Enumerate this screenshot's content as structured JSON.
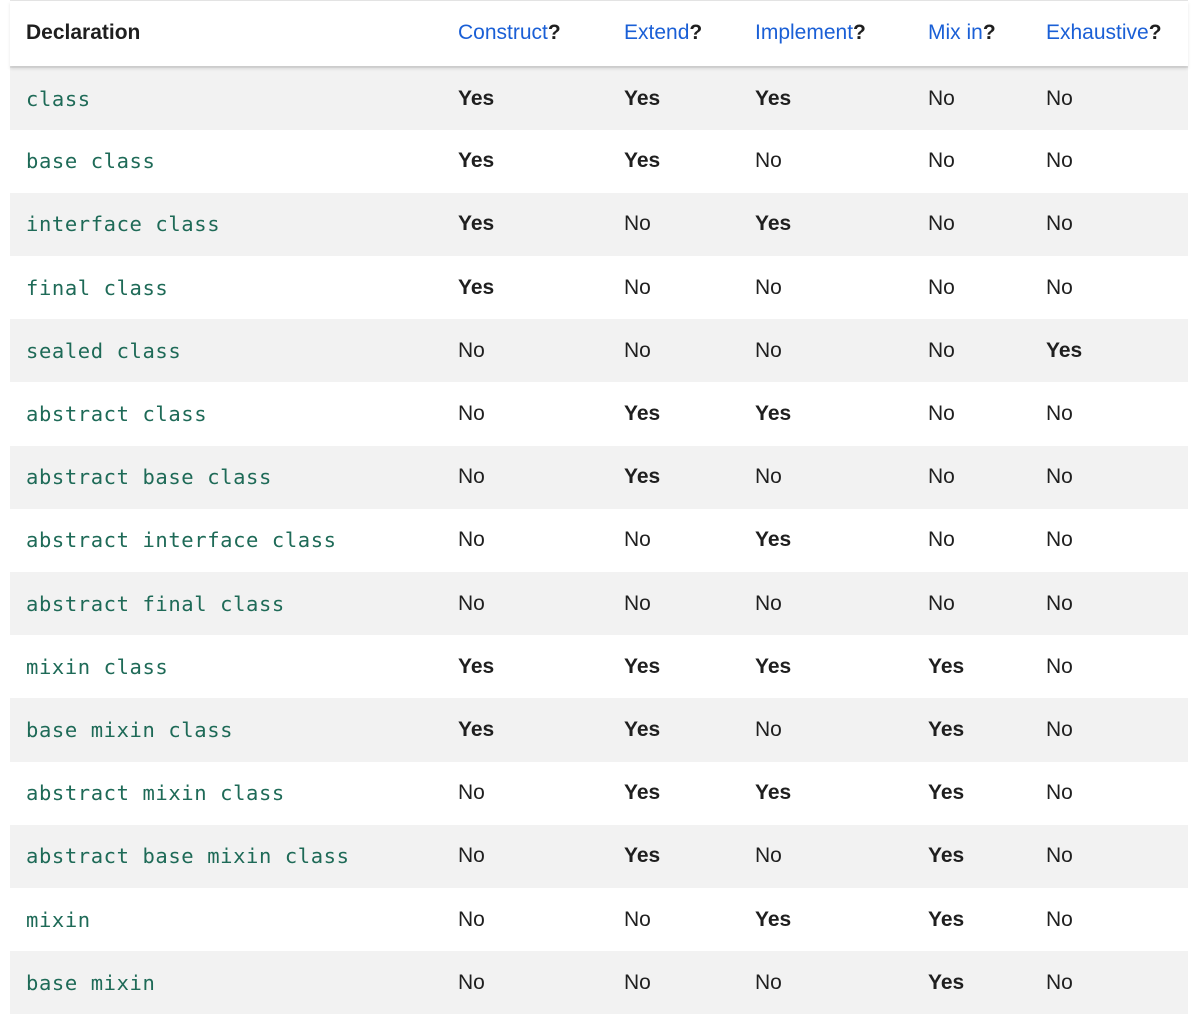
{
  "table": {
    "headers": [
      {
        "text": "Declaration",
        "link": false
      },
      {
        "text": "Construct",
        "link": true,
        "suffix": "?"
      },
      {
        "text": "Extend",
        "link": true,
        "suffix": "?"
      },
      {
        "text": "Implement",
        "link": true,
        "suffix": "?"
      },
      {
        "text": "Mix in",
        "link": true,
        "suffix": "?"
      },
      {
        "text": "Exhaustive",
        "link": true,
        "suffix": "?"
      }
    ],
    "rows": [
      {
        "declaration": "class",
        "values": [
          "Yes",
          "Yes",
          "Yes",
          "No",
          "No"
        ]
      },
      {
        "declaration": "base class",
        "values": [
          "Yes",
          "Yes",
          "No",
          "No",
          "No"
        ]
      },
      {
        "declaration": "interface class",
        "values": [
          "Yes",
          "No",
          "Yes",
          "No",
          "No"
        ]
      },
      {
        "declaration": "final class",
        "values": [
          "Yes",
          "No",
          "No",
          "No",
          "No"
        ]
      },
      {
        "declaration": "sealed class",
        "values": [
          "No",
          "No",
          "No",
          "No",
          "Yes"
        ]
      },
      {
        "declaration": "abstract class",
        "values": [
          "No",
          "Yes",
          "Yes",
          "No",
          "No"
        ]
      },
      {
        "declaration": "abstract base class",
        "values": [
          "No",
          "Yes",
          "No",
          "No",
          "No"
        ]
      },
      {
        "declaration": "abstract interface class",
        "values": [
          "No",
          "No",
          "Yes",
          "No",
          "No"
        ]
      },
      {
        "declaration": "abstract final class",
        "values": [
          "No",
          "No",
          "No",
          "No",
          "No"
        ]
      },
      {
        "declaration": "mixin class",
        "values": [
          "Yes",
          "Yes",
          "Yes",
          "Yes",
          "No"
        ]
      },
      {
        "declaration": "base mixin class",
        "values": [
          "Yes",
          "Yes",
          "No",
          "Yes",
          "No"
        ]
      },
      {
        "declaration": "abstract mixin class",
        "values": [
          "No",
          "Yes",
          "Yes",
          "Yes",
          "No"
        ]
      },
      {
        "declaration": "abstract base mixin class",
        "values": [
          "No",
          "Yes",
          "No",
          "Yes",
          "No"
        ]
      },
      {
        "declaration": "mixin",
        "values": [
          "No",
          "No",
          "Yes",
          "Yes",
          "No"
        ]
      },
      {
        "declaration": "base mixin",
        "values": [
          "No",
          "No",
          "No",
          "Yes",
          "No"
        ]
      }
    ]
  },
  "colors": {
    "link": "#1a5fd6",
    "code": "#1e6a57",
    "stripe": "#f2f2f2"
  }
}
